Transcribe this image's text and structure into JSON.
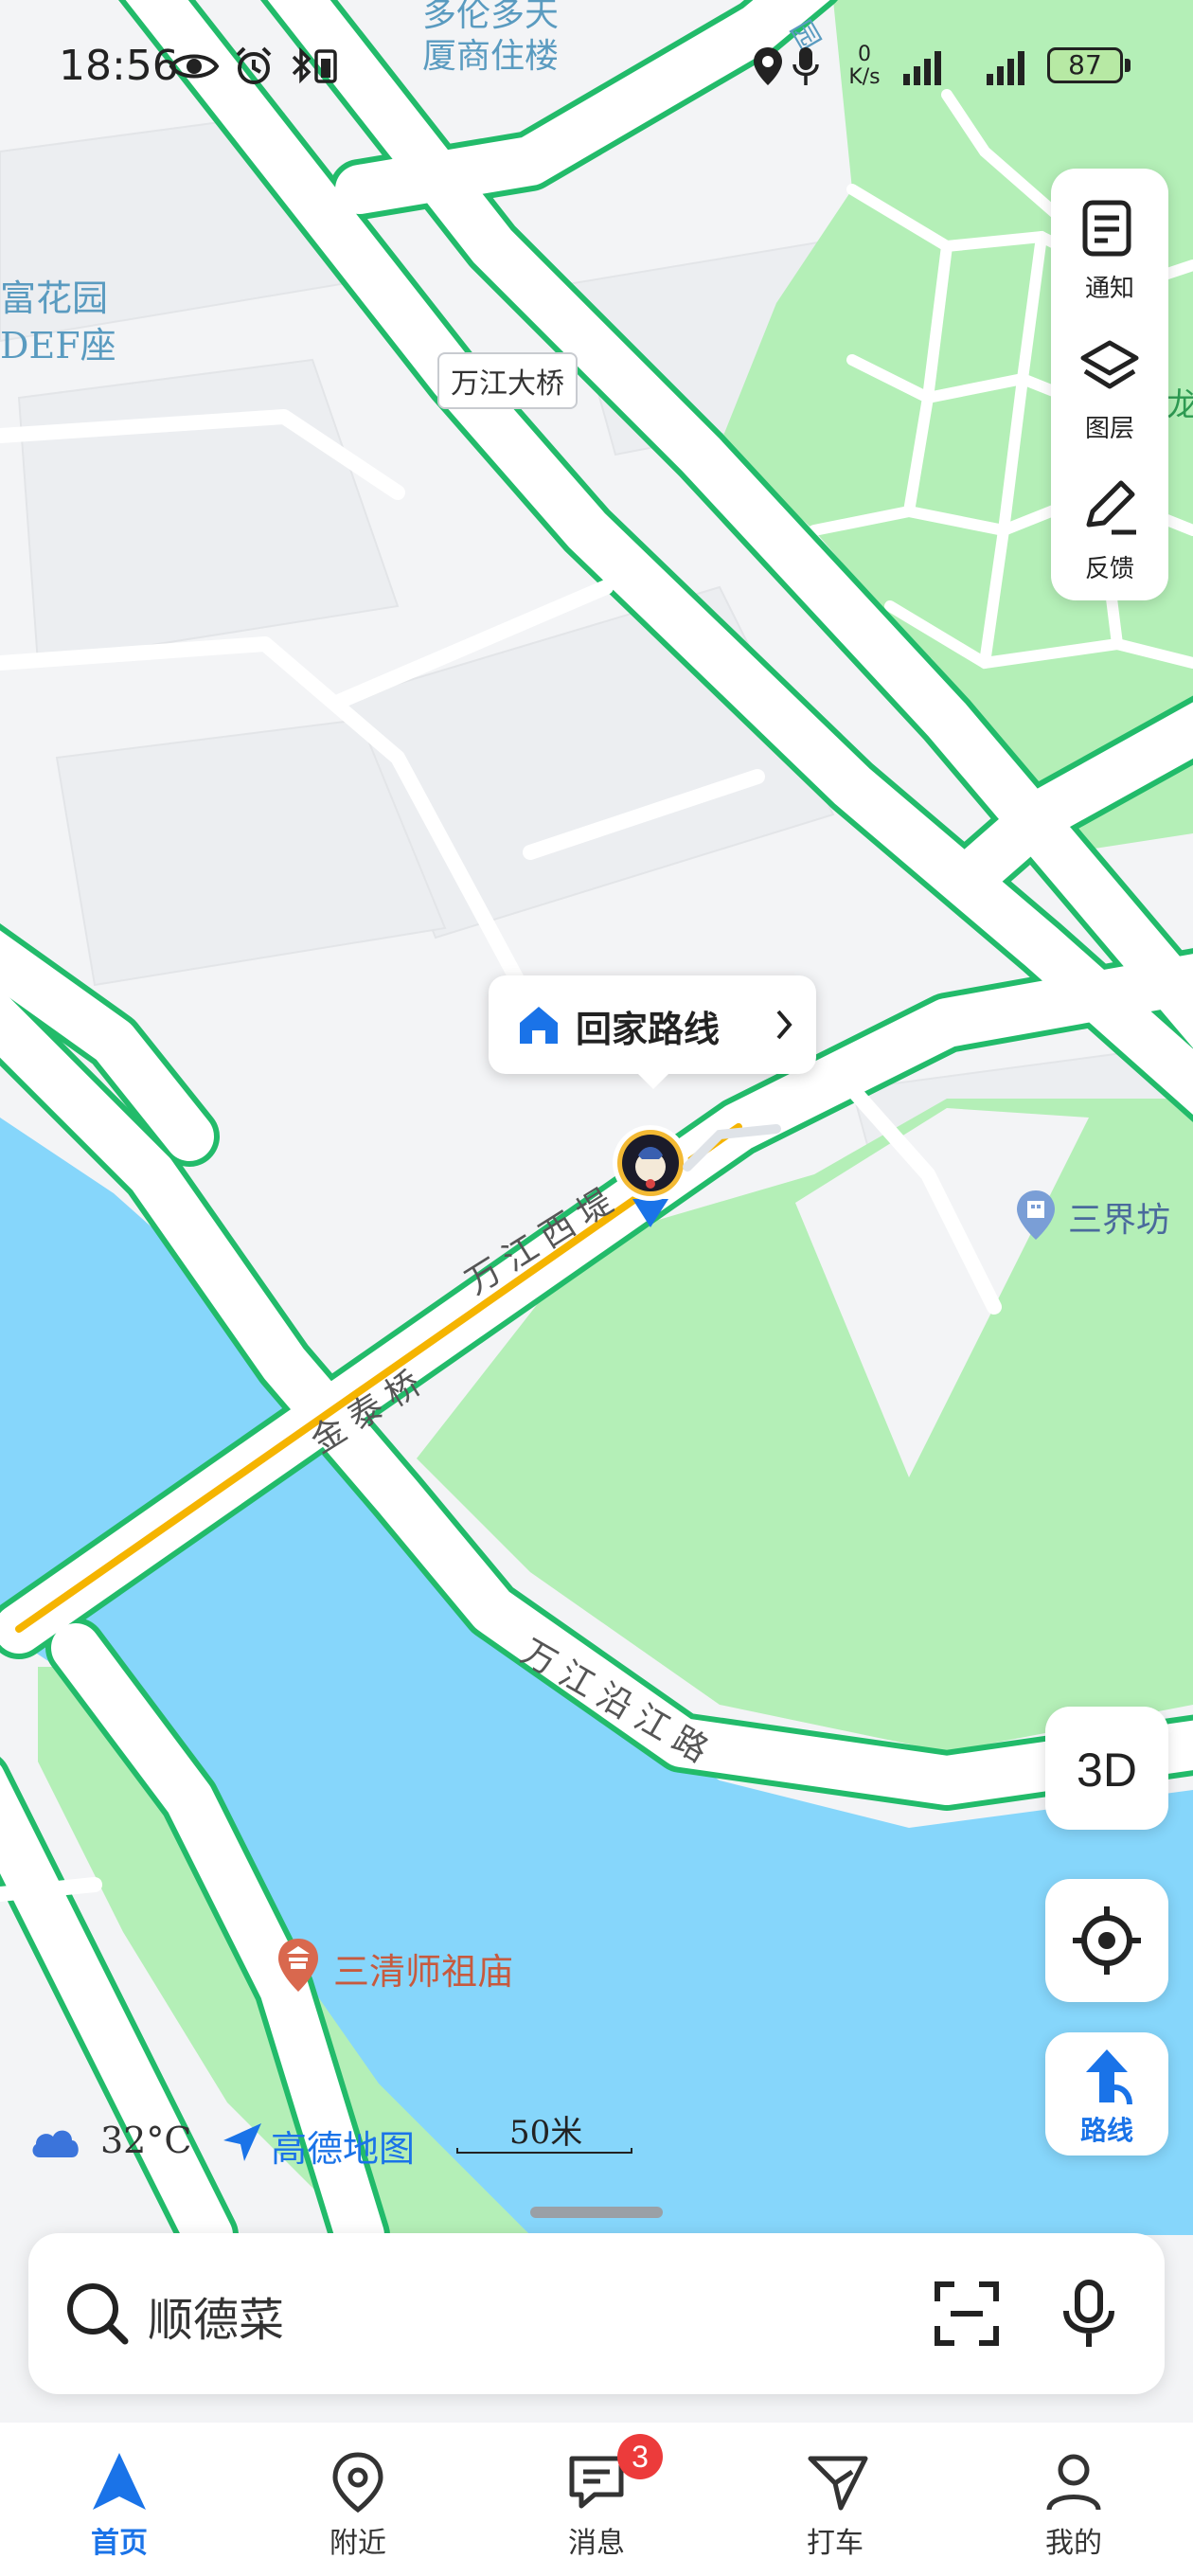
{
  "status_bar": {
    "time": "18:56",
    "net_speed_value": "0",
    "net_speed_unit": "K/s",
    "battery": "87"
  },
  "map": {
    "labels": {
      "top_building_line1": "多伦多天",
      "top_building_line2": "厦商住楼",
      "left_estate_line1": "富花园",
      "left_estate_line2": "DEF座",
      "bridge_name": "万江大桥",
      "top_right_park_frag": "园",
      "right_edge_frag": "龙",
      "road_wanjiang_west": "万江西堤",
      "road_jintai_bridge": "金泰桥",
      "road_riverside": "万江沿江路",
      "poi_sanjie": "三界坊",
      "poi_temple": "三清师祖庙"
    },
    "colors": {
      "water": "#86d6fb",
      "green": "#b4efb7",
      "park_lines": "#ffffff",
      "road_outline": "#22bb6a",
      "land": "#f3f4f6",
      "accent_blue": "#1a73e8"
    }
  },
  "callout": {
    "label": "回家路线"
  },
  "toolbar": {
    "notice_label": "通知",
    "layers_label": "图层",
    "feedback_label": "反馈"
  },
  "buttons": {
    "three_d": "3D",
    "route_label": "路线"
  },
  "weather": {
    "temperature": "32°C"
  },
  "brand": {
    "name": "高德地图"
  },
  "scale": {
    "label": "50米"
  },
  "search": {
    "value": "顺德菜"
  },
  "tabbar": {
    "home": "首页",
    "nearby": "附近",
    "messages": "消息",
    "messages_badge": "3",
    "taxi": "打车",
    "mine": "我的"
  }
}
